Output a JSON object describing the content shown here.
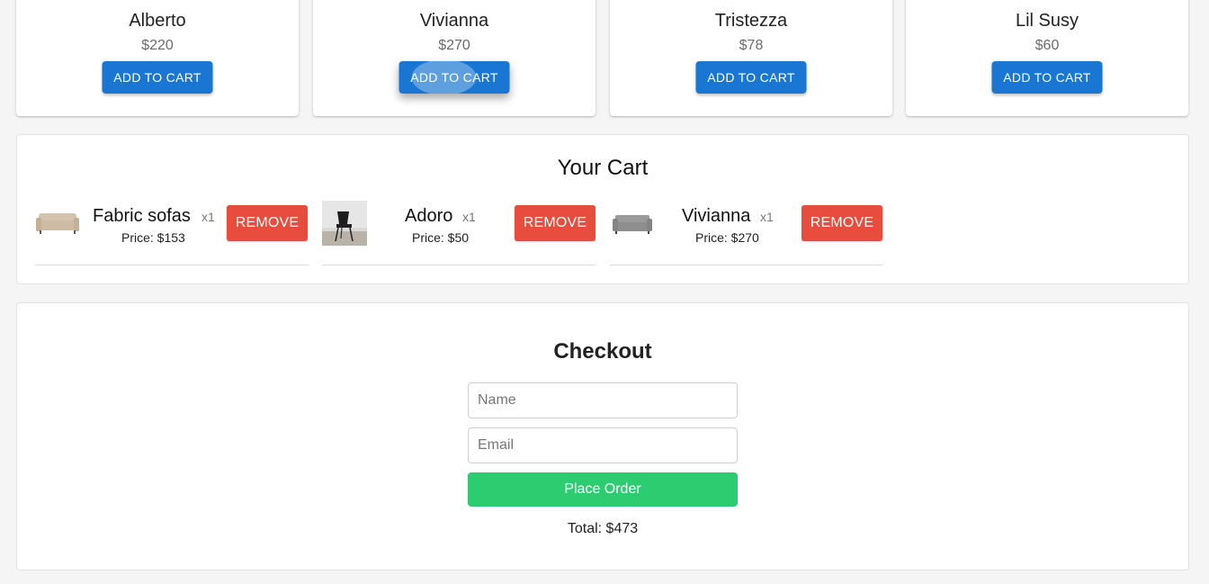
{
  "products": [
    {
      "name": "Alberto",
      "price": "$220",
      "button": "ADD TO CART"
    },
    {
      "name": "Vivianna",
      "price": "$270",
      "button": "ADD TO CART"
    },
    {
      "name": "Tristezza",
      "price": "$78",
      "button": "ADD TO CART"
    },
    {
      "name": "Lil Susy",
      "price": "$60",
      "button": "ADD TO CART"
    }
  ],
  "cart": {
    "title": "Your Cart",
    "items": [
      {
        "name": "Fabric sofas",
        "qty": "x1",
        "price": "Price: $153",
        "remove": "REMOVE",
        "thumb": "beige-sofa-image"
      },
      {
        "name": "Adoro",
        "qty": "x1",
        "price": "Price: $50",
        "remove": "REMOVE",
        "thumb": "black-chair-image"
      },
      {
        "name": "Vivianna",
        "qty": "x1",
        "price": "Price: $270",
        "remove": "REMOVE",
        "thumb": "grey-sofa-image"
      }
    ]
  },
  "checkout": {
    "title": "Checkout",
    "name_placeholder": "Name",
    "email_placeholder": "Email",
    "place_order": "Place Order",
    "total": "Total: $473"
  },
  "colors": {
    "primary": "#1976d2",
    "remove": "#e74c3c",
    "order": "#2ecc71"
  }
}
